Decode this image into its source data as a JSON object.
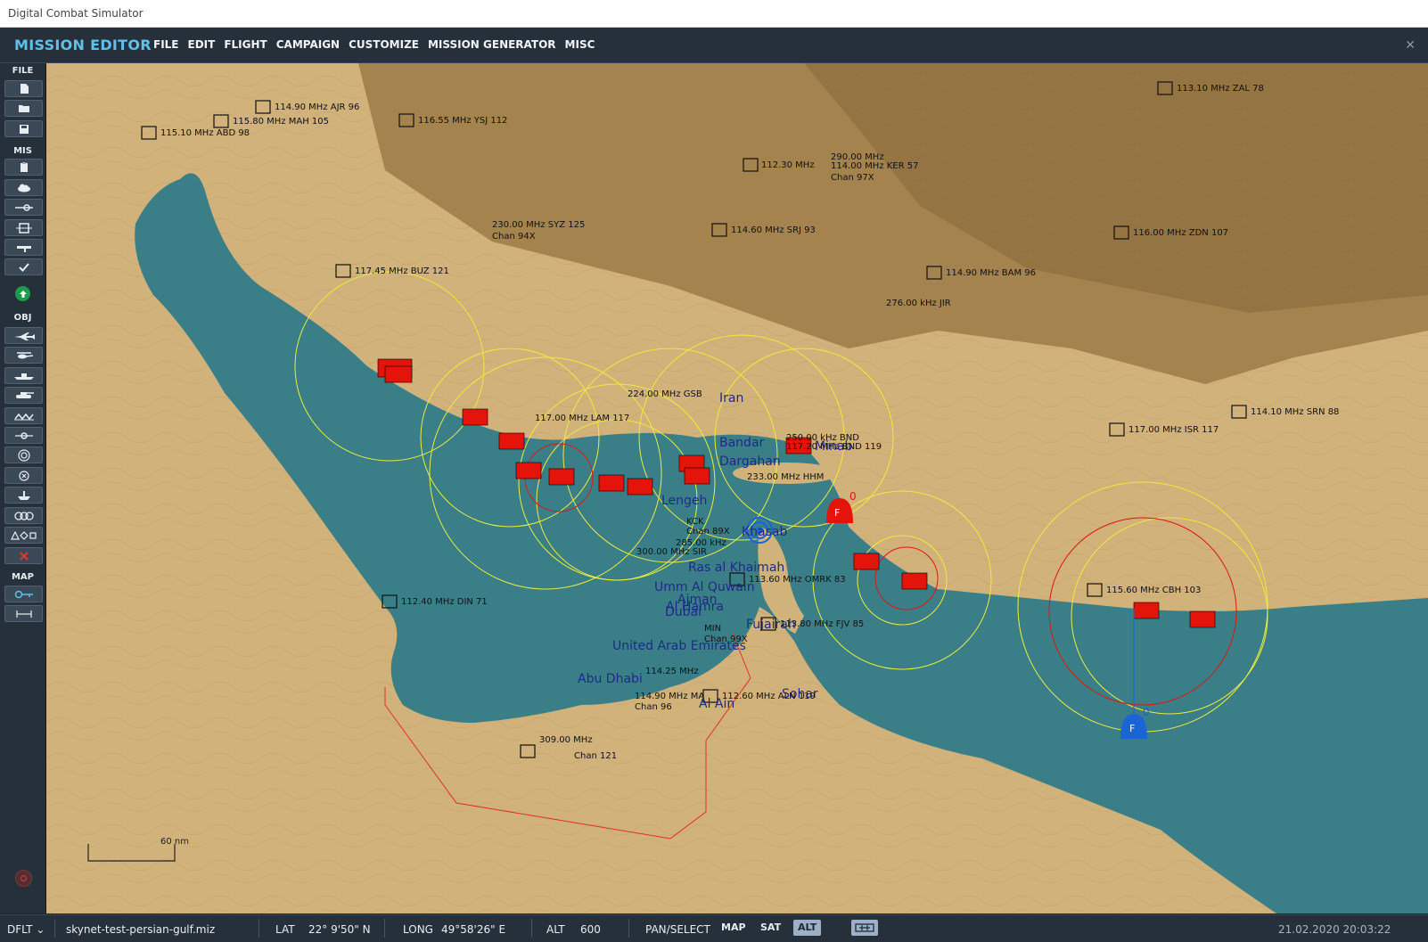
{
  "window": {
    "title": "Digital Combat Simulator"
  },
  "app": {
    "title": "MISSION EDITOR"
  },
  "menu": [
    "FILE",
    "EDIT",
    "FLIGHT",
    "CAMPAIGN",
    "CUSTOMIZE",
    "MISSION GENERATOR",
    "MISC"
  ],
  "toolbar": {
    "file": "FILE",
    "mis": "MIS",
    "obj": "OBJ",
    "map": "MAP"
  },
  "map": {
    "scale_label": "60 nm",
    "places": [
      "Bandar",
      "Dargahan",
      "Lengeh",
      "Khasab",
      "Minab",
      "Iran",
      "Ras al Khaimah",
      "Umm Al Quwain",
      "Ajman",
      "Al Hamra",
      "Dubai",
      "Fujairah",
      "United Arab Emirates",
      "Abu Dhabi",
      "Al Ain",
      "Sohar"
    ],
    "navaids": [
      "115.10 MHz ABD 98",
      "115.80 MHz MAH 105",
      "114.90 MHz AJR 96",
      "116.55 MHz YSJ 112",
      "113.10 MHz ZAL 78",
      "112.30 MHz",
      "290.00 MHz",
      "114.00 MHz KER 57",
      "Chan 97X",
      "116.00 MHz ZDN 107",
      "114.60 MHz SRJ 93",
      "230.00 MHz SYZ 125",
      "Chan 94X",
      "117.45 MHz BUZ 121",
      "114.90 MHz BAM 96",
      "276.00 kHz JIR",
      "114.10 MHz SRN 88",
      "117.00 MHz ISR 117",
      "224.00 MHz GSB",
      "117.00 MHz LAM 117",
      "250.00 kHz BND",
      "117.20 MHz BND 119",
      "233.00 MHz HHM",
      "KCK",
      "Chan 89X",
      "285.00 kHz",
      "300.00 MHz SIR",
      "113.60 MHz OMRK 83",
      "115.60 MHz CBH 103",
      "112.40 MHz DIN 71",
      "MIN",
      "Chan 99X",
      "113.80 MHz FJV 85",
      "114.25 MHz",
      "114.90 MHz MA",
      "Chan 96",
      "112.60 MHz ALN 119",
      "309.00 MHz",
      "Chan 121"
    ],
    "unit_labels": [
      "F",
      "0",
      "F",
      "0"
    ]
  },
  "status": {
    "coalition": "DFLT",
    "file": "skynet-test-persian-gulf.miz",
    "lat_label": "LAT",
    "lat": "22° 9'50\" N",
    "long_label": "LONG",
    "long": "49°58'26\" E",
    "alt_label": "ALT",
    "alt": "600",
    "pan_label": "PAN/SELECT",
    "map_btn": "MAP",
    "sat_btn": "SAT",
    "alt_btn": "ALT",
    "datetime": "21.02.2020 20:03:22"
  },
  "colors": {
    "land": "#c9aa6f",
    "sea": "#3a7f88",
    "threat_ring": "#ecec3a",
    "red_unit": "#e5140a",
    "blue_unit": "#1a64d6",
    "accent": "#5fc0ea"
  }
}
